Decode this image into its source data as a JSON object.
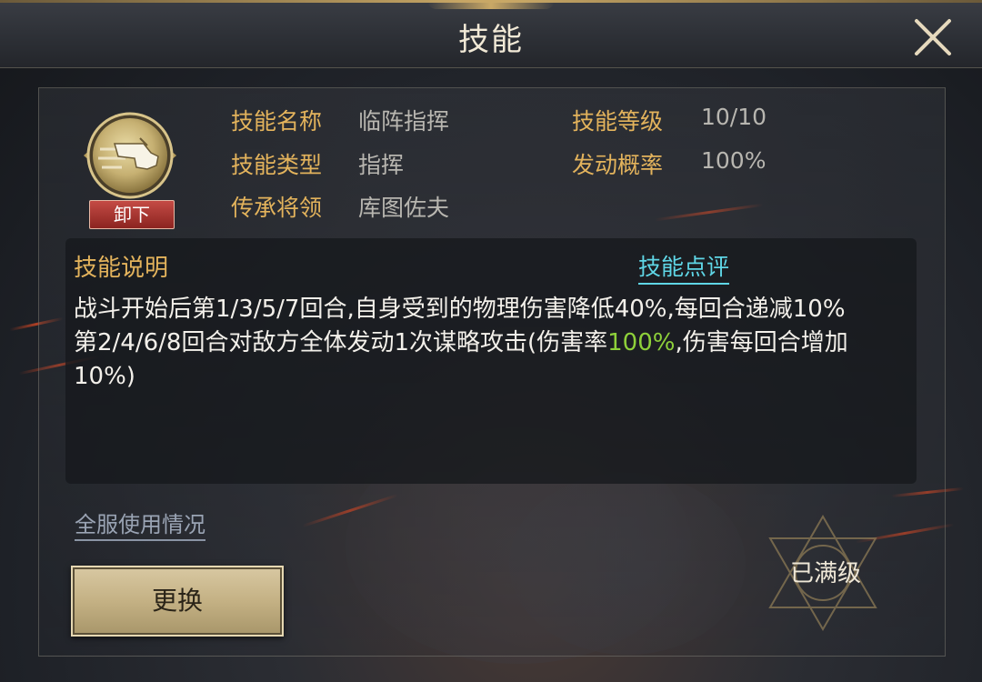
{
  "header": {
    "title": "技能"
  },
  "skill": {
    "unload_label": "卸下",
    "info": {
      "name_label": "技能名称",
      "name_value": "临阵指挥",
      "type_label": "技能类型",
      "type_value": "指挥",
      "inherit_label": "传承将领",
      "inherit_value": "库图佐夫",
      "level_label": "技能等级",
      "level_value": "10/10",
      "chance_label": "发动概率",
      "chance_value": "100%"
    }
  },
  "description": {
    "title": "技能说明",
    "review_link": "技能点评",
    "line1": "战斗开始后第1/3/5/7回合,自身受到的物理伤害降低40%,每回合递减10%",
    "line2_part1": "第2/4/6/8回合对敌方全体发动1次谋略攻击(伤害率",
    "line2_highlight": "100%",
    "line2_part2": ",伤害每回合增加10%)"
  },
  "footer": {
    "usage_link": "全服使用情况",
    "change_button": "更换",
    "maxed_label": "已满级"
  },
  "colors": {
    "label_gold": "#e3b35c",
    "value_gray": "#b8b6b0",
    "link_cyan": "#5fd6e6",
    "highlight_green": "#8ed03a",
    "unload_red": "#a8302b"
  }
}
